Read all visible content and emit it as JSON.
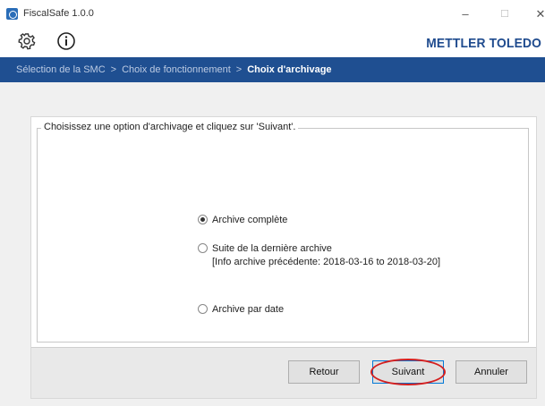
{
  "window": {
    "title": "FiscalSafe 1.0.0",
    "min_glyph": "–",
    "max_glyph": "☐",
    "close_glyph": "✕"
  },
  "toolbar": {
    "settings_icon": "gear-icon",
    "info_icon": "info-icon",
    "brand": "METTLER TOLEDO"
  },
  "breadcrumb": {
    "items": [
      "Sélection de la SMC",
      "Choix de fonctionnement",
      "Choix d'archivage"
    ],
    "separator": ">"
  },
  "form": {
    "legend": "Choisissez une option d'archivage et cliquez sur 'Suivant'.",
    "options": [
      {
        "label": "Archive complète",
        "selected": true
      },
      {
        "label": "Suite de la dernière archive",
        "selected": false
      },
      {
        "label": "Archive par date",
        "selected": false
      }
    ],
    "previous_info": "[Info archive précédente: 2018-03-16 to 2018-03-20]"
  },
  "buttons": {
    "back": "Retour",
    "next": "Suivant",
    "cancel": "Annuler"
  },
  "colors": {
    "breadcrumb_bg": "#1f4f91",
    "brand": "#1f4b8e",
    "highlight": "#d41f1f"
  }
}
